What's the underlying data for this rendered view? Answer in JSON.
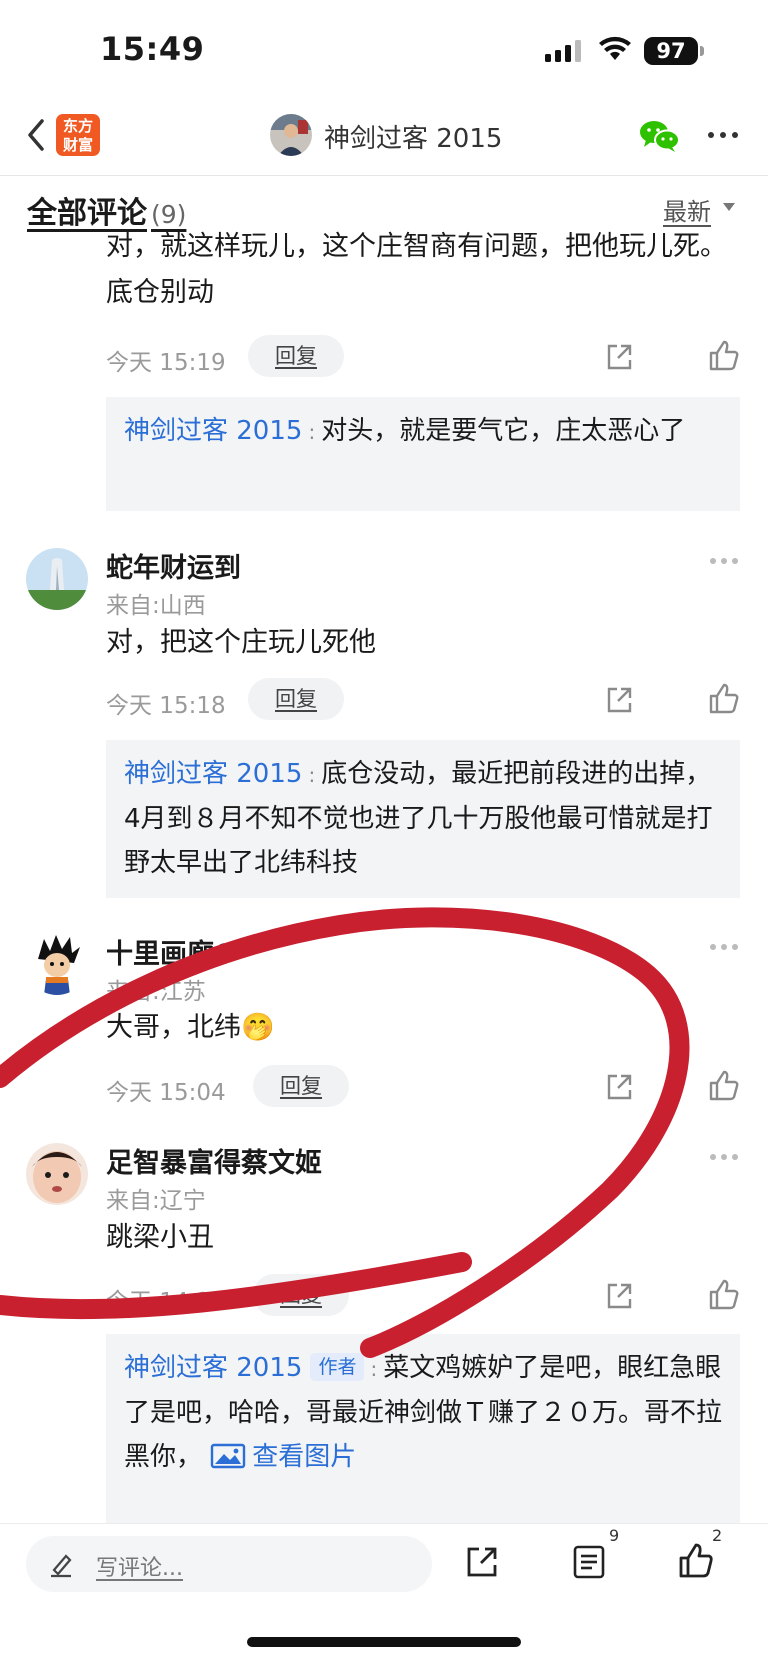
{
  "status": {
    "time": "15:49",
    "battery": "97"
  },
  "nav": {
    "logo_line1": "东方",
    "logo_line2": "财富",
    "title": "神剑过客 2015"
  },
  "section": {
    "title": "全部评论",
    "count": "(9)",
    "sort": "最新"
  },
  "comments": [
    {
      "body": "对，就这样玩儿，这个庄智商有问题，把他玩儿死。底仓别动",
      "time": "今天 15:19",
      "reply_label": "回复",
      "reply": {
        "author": "神剑过客 2015",
        "text": "对头，就是要气它，庄太恶心了"
      }
    },
    {
      "username": "蛇年财运到",
      "location": "来自:山西",
      "body": "对，把这个庄玩儿死他",
      "time": "今天 15:18",
      "reply_label": "回复",
      "reply": {
        "author": "神剑过客 2015",
        "text": "底仓没动，最近把前段进的出掉，4月到８月不知不觉也进了几十万股他最可惜就是打野太早出了北纬科技"
      }
    },
    {
      "username": "十里画廊6",
      "location": "来自:江苏",
      "body": "大哥，北纬",
      "emoji": "🤭",
      "time": "今天 15:04",
      "reply_label": "回复"
    },
    {
      "username": "足智暴富得蔡文姬",
      "location": "来自:辽宁",
      "body": "跳梁小丑",
      "time": "今天 14:27",
      "reply_label": "回复",
      "reply": {
        "author": "神剑过客 2015",
        "author_tag": "作者",
        "text": "菜文鸡嫉妒了是吧，眼红急眼了是吧，哈哈，哥最近神剑做Ｔ赚了２０万。哥不拉黑你，",
        "link": "查看图片"
      }
    }
  ],
  "bottom": {
    "placeholder": "写评论...",
    "list_count": "9",
    "like_count": "2"
  },
  "colors": {
    "accent_blue": "#2b6fd6",
    "logo_orange": "#f05a22",
    "annotation_red": "#c8202f",
    "wechat_green": "#2dc100"
  }
}
